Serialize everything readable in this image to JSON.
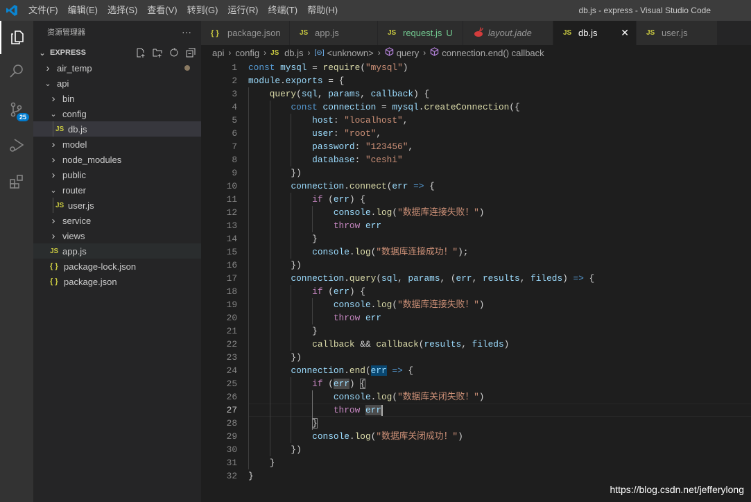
{
  "titlebar": {
    "menus": [
      "文件(F)",
      "编辑(E)",
      "选择(S)",
      "查看(V)",
      "转到(G)",
      "运行(R)",
      "终端(T)",
      "帮助(H)"
    ],
    "title": "db.js - express - Visual Studio Code"
  },
  "activity": {
    "items": [
      "explorer-icon",
      "search-icon",
      "source-control-icon",
      "run-debug-icon",
      "extensions-icon"
    ],
    "scm_badge": "25"
  },
  "sidebar": {
    "title": "资源管理器",
    "more": "···",
    "section": "EXPRESS",
    "tree": [
      {
        "label": "air_temp",
        "type": "folder",
        "open": false,
        "depth": 0,
        "modified": true
      },
      {
        "label": "api",
        "type": "folder",
        "open": true,
        "depth": 0
      },
      {
        "label": "bin",
        "type": "folder",
        "open": false,
        "depth": 1
      },
      {
        "label": "config",
        "type": "folder",
        "open": true,
        "depth": 1
      },
      {
        "label": "db.js",
        "type": "js",
        "depth": 2,
        "selected": true
      },
      {
        "label": "model",
        "type": "folder",
        "open": false,
        "depth": 1
      },
      {
        "label": "node_modules",
        "type": "folder",
        "open": false,
        "depth": 1
      },
      {
        "label": "public",
        "type": "folder",
        "open": false,
        "depth": 1
      },
      {
        "label": "router",
        "type": "folder",
        "open": true,
        "depth": 1
      },
      {
        "label": "user.js",
        "type": "js",
        "depth": 2
      },
      {
        "label": "service",
        "type": "folder",
        "open": false,
        "depth": 1
      },
      {
        "label": "views",
        "type": "folder",
        "open": false,
        "depth": 1
      },
      {
        "label": "app.js",
        "type": "js",
        "depth": 1,
        "hover": true
      },
      {
        "label": "package-lock.json",
        "type": "json",
        "depth": 1
      },
      {
        "label": "package.json",
        "type": "json",
        "depth": 1
      }
    ]
  },
  "tabs": [
    {
      "label": "package.json",
      "icon": "json",
      "width": 128
    },
    {
      "label": "app.js",
      "icon": "js",
      "width": 127
    },
    {
      "label": "request.js",
      "icon": "js",
      "status": "U",
      "color": "#73c991",
      "width": 123
    },
    {
      "label": "layout.jade",
      "icon": "jade",
      "italic": true,
      "width": 130
    },
    {
      "label": "db.js",
      "icon": "js",
      "active": true,
      "close": "✕",
      "width": 120
    },
    {
      "label": "user.js",
      "icon": "js",
      "width": 117
    }
  ],
  "breadcrumb": [
    "api",
    "config",
    "db.js",
    "<unknown>",
    "query",
    "connection.end() callback"
  ],
  "editor": {
    "current_line": 27,
    "lines": [
      [
        [
          "const",
          "k"
        ],
        [
          " ",
          "p"
        ],
        [
          "mysql",
          "v"
        ],
        [
          " = ",
          "p"
        ],
        [
          "require",
          "f"
        ],
        [
          "(",
          "p"
        ],
        [
          "\"mysql\"",
          "s"
        ],
        [
          ")",
          "p"
        ]
      ],
      [
        [
          "module",
          "v"
        ],
        [
          ".",
          "p"
        ],
        [
          "exports",
          "v"
        ],
        [
          " = {",
          "p"
        ]
      ],
      [
        [
          "    ",
          "p"
        ],
        [
          "query",
          "f"
        ],
        [
          "(",
          "p"
        ],
        [
          "sql",
          "v"
        ],
        [
          ", ",
          "p"
        ],
        [
          "params",
          "v"
        ],
        [
          ", ",
          "p"
        ],
        [
          "callback",
          "v"
        ],
        [
          ") {",
          "p"
        ]
      ],
      [
        [
          "        ",
          "p"
        ],
        [
          "const",
          "k"
        ],
        [
          " ",
          "p"
        ],
        [
          "connection",
          "v"
        ],
        [
          " = ",
          "p"
        ],
        [
          "mysql",
          "v"
        ],
        [
          ".",
          "p"
        ],
        [
          "createConnection",
          "f"
        ],
        [
          "({",
          "p"
        ]
      ],
      [
        [
          "            ",
          "p"
        ],
        [
          "host",
          "v"
        ],
        [
          ": ",
          "p"
        ],
        [
          "\"localhost\"",
          "s"
        ],
        [
          ",",
          "p"
        ]
      ],
      [
        [
          "            ",
          "p"
        ],
        [
          "user",
          "v"
        ],
        [
          ": ",
          "p"
        ],
        [
          "\"root\"",
          "s"
        ],
        [
          ",",
          "p"
        ]
      ],
      [
        [
          "            ",
          "p"
        ],
        [
          "password",
          "v"
        ],
        [
          ": ",
          "p"
        ],
        [
          "\"123456\"",
          "s"
        ],
        [
          ",",
          "p"
        ]
      ],
      [
        [
          "            ",
          "p"
        ],
        [
          "database",
          "v"
        ],
        [
          ": ",
          "p"
        ],
        [
          "\"ceshi\"",
          "s"
        ]
      ],
      [
        [
          "        })",
          "p"
        ]
      ],
      [
        [
          "        ",
          "p"
        ],
        [
          "connection",
          "v"
        ],
        [
          ".",
          "p"
        ],
        [
          "connect",
          "f"
        ],
        [
          "(",
          "p"
        ],
        [
          "err",
          "v"
        ],
        [
          " ",
          "p"
        ],
        [
          "=>",
          "k"
        ],
        [
          " {",
          "p"
        ]
      ],
      [
        [
          "            ",
          "p"
        ],
        [
          "if",
          "c"
        ],
        [
          " (",
          "p"
        ],
        [
          "err",
          "v"
        ],
        [
          ") {",
          "p"
        ]
      ],
      [
        [
          "                ",
          "p"
        ],
        [
          "console",
          "v"
        ],
        [
          ".",
          "p"
        ],
        [
          "log",
          "f"
        ],
        [
          "(",
          "p"
        ],
        [
          "\"数据库连接失败！\"",
          "s"
        ],
        [
          ")",
          "p"
        ]
      ],
      [
        [
          "                ",
          "p"
        ],
        [
          "throw",
          "c"
        ],
        [
          " ",
          "p"
        ],
        [
          "err",
          "v"
        ]
      ],
      [
        [
          "            }",
          "p"
        ]
      ],
      [
        [
          "            ",
          "p"
        ],
        [
          "console",
          "v"
        ],
        [
          ".",
          "p"
        ],
        [
          "log",
          "f"
        ],
        [
          "(",
          "p"
        ],
        [
          "\"数据库连接成功！\"",
          "s"
        ],
        [
          ");",
          "p"
        ]
      ],
      [
        [
          "        })",
          "p"
        ]
      ],
      [
        [
          "        ",
          "p"
        ],
        [
          "connection",
          "v"
        ],
        [
          ".",
          "p"
        ],
        [
          "query",
          "f"
        ],
        [
          "(",
          "p"
        ],
        [
          "sql",
          "v"
        ],
        [
          ", ",
          "p"
        ],
        [
          "params",
          "v"
        ],
        [
          ", (",
          "p"
        ],
        [
          "err",
          "v"
        ],
        [
          ", ",
          "p"
        ],
        [
          "results",
          "v"
        ],
        [
          ", ",
          "p"
        ],
        [
          "fileds",
          "v"
        ],
        [
          ") ",
          "p"
        ],
        [
          "=>",
          "k"
        ],
        [
          " {",
          "p"
        ]
      ],
      [
        [
          "            ",
          "p"
        ],
        [
          "if",
          "c"
        ],
        [
          " (",
          "p"
        ],
        [
          "err",
          "v"
        ],
        [
          ") {",
          "p"
        ]
      ],
      [
        [
          "                ",
          "p"
        ],
        [
          "console",
          "v"
        ],
        [
          ".",
          "p"
        ],
        [
          "log",
          "f"
        ],
        [
          "(",
          "p"
        ],
        [
          "\"数据库连接失败！\"",
          "s"
        ],
        [
          ")",
          "p"
        ]
      ],
      [
        [
          "                ",
          "p"
        ],
        [
          "throw",
          "c"
        ],
        [
          " ",
          "p"
        ],
        [
          "err",
          "v"
        ]
      ],
      [
        [
          "            }",
          "p"
        ]
      ],
      [
        [
          "            ",
          "p"
        ],
        [
          "callback",
          "f"
        ],
        [
          " && ",
          "p"
        ],
        [
          "callback",
          "f"
        ],
        [
          "(",
          "p"
        ],
        [
          "results",
          "v"
        ],
        [
          ", ",
          "p"
        ],
        [
          "fileds",
          "v"
        ],
        [
          ")",
          "p"
        ]
      ],
      [
        [
          "        })",
          "p"
        ]
      ],
      [
        [
          "        ",
          "p"
        ],
        [
          "connection",
          "v"
        ],
        [
          ".",
          "p"
        ],
        [
          "end",
          "f"
        ],
        [
          "(",
          "p"
        ],
        [
          "err",
          "v",
          "w"
        ],
        [
          " ",
          "p"
        ],
        [
          "=>",
          "k"
        ],
        [
          " {",
          "p"
        ]
      ],
      [
        [
          "            ",
          "p"
        ],
        [
          "if",
          "c"
        ],
        [
          " (",
          "p"
        ],
        [
          "err",
          "v",
          "r"
        ],
        [
          ") ",
          "p"
        ],
        [
          "{",
          "p",
          "b"
        ]
      ],
      [
        [
          "                ",
          "p"
        ],
        [
          "console",
          "v"
        ],
        [
          ".",
          "p"
        ],
        [
          "log",
          "f"
        ],
        [
          "(",
          "p"
        ],
        [
          "\"数据库关闭失败！\"",
          "s"
        ],
        [
          ")",
          "p"
        ]
      ],
      [
        [
          "                ",
          "p"
        ],
        [
          "throw",
          "c"
        ],
        [
          " ",
          "p"
        ],
        [
          "err",
          "v",
          "r"
        ]
      ],
      [
        [
          "            ",
          "p"
        ],
        [
          "}",
          "p",
          "b"
        ]
      ],
      [
        [
          "            ",
          "p"
        ],
        [
          "console",
          "v"
        ],
        [
          ".",
          "p"
        ],
        [
          "log",
          "f"
        ],
        [
          "(",
          "p"
        ],
        [
          "\"数据库关闭成功！\"",
          "s"
        ],
        [
          ")",
          "p"
        ]
      ],
      [
        [
          "        })",
          "p"
        ]
      ],
      [
        [
          "    }",
          "p"
        ]
      ],
      [
        [
          "}",
          "p"
        ]
      ]
    ]
  },
  "watermark": "https://blog.csdn.net/jefferylong",
  "colors": {
    "accent": "#007acc",
    "js_icon": "#cbcb41",
    "untracked": "#73c991",
    "jade_icon": "#d33c3c"
  }
}
